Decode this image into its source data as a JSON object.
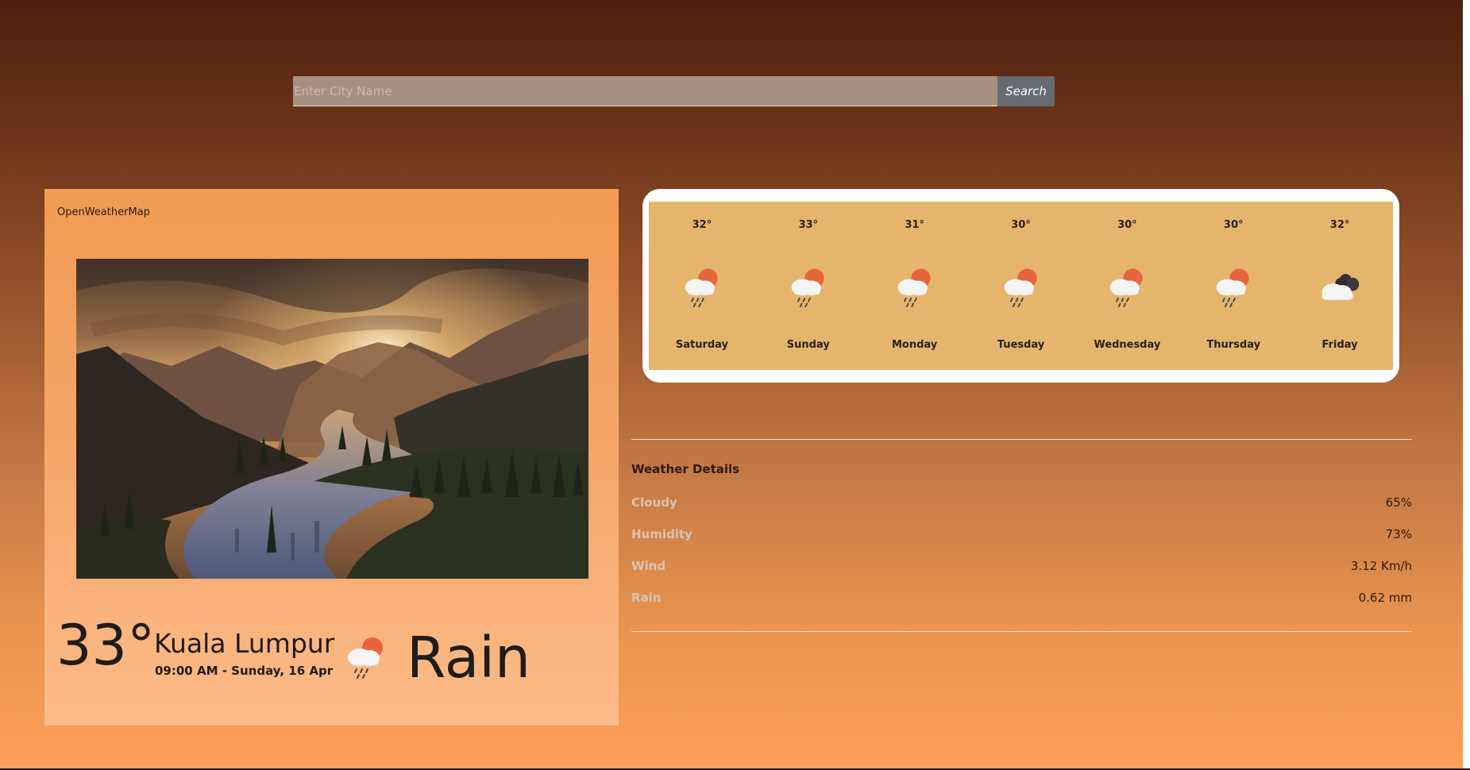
{
  "search": {
    "placeholder": "Enter City Name",
    "value": "",
    "button_label": "Search"
  },
  "current": {
    "brand": "OpenWeatherMap",
    "scene_image": "mountain-river-sunset-landscape",
    "temperature": "33°",
    "city": "Kuala Lumpur",
    "datetime": "09:00 AM - Sunday, 16 Apr",
    "icon": "cloud-sun-rain-icon",
    "condition": "Rain"
  },
  "forecast": [
    {
      "temp": "32°",
      "day": "Saturday",
      "icon": "cloud-sun-rain-icon"
    },
    {
      "temp": "33°",
      "day": "Sunday",
      "icon": "cloud-sun-rain-icon"
    },
    {
      "temp": "31°",
      "day": "Monday",
      "icon": "cloud-sun-rain-icon"
    },
    {
      "temp": "30°",
      "day": "Tuesday",
      "icon": "cloud-sun-rain-icon"
    },
    {
      "temp": "30°",
      "day": "Wednesday",
      "icon": "cloud-sun-rain-icon"
    },
    {
      "temp": "30°",
      "day": "Thursday",
      "icon": "cloud-sun-rain-icon"
    },
    {
      "temp": "32°",
      "day": "Friday",
      "icon": "cloudy-icon"
    }
  ],
  "details": {
    "title": "Weather Details",
    "rows": [
      {
        "label": "Cloudy",
        "value": "65%"
      },
      {
        "label": "Humidity",
        "value": "73%"
      },
      {
        "label": "Wind",
        "value": "3.12 Km/h"
      },
      {
        "label": "Rain",
        "value": "0.62 mm"
      }
    ]
  },
  "colors": {
    "background_top": "#4e1f10",
    "background_bottom": "#fca05a",
    "card": "#f5a566",
    "forecast_panel": "#e5b56d",
    "search_input": "#a89081",
    "search_button": "#686a72",
    "detail_label": "#d8c3b6"
  }
}
